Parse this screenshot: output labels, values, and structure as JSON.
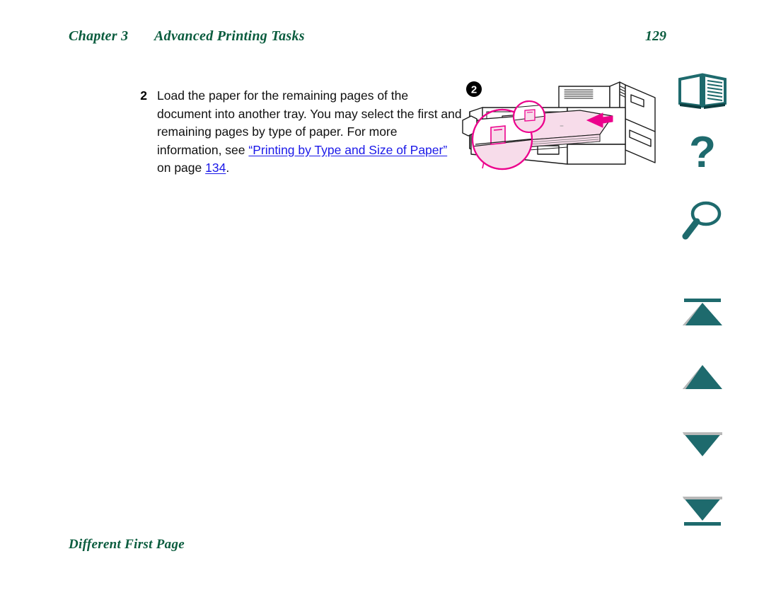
{
  "header": {
    "chapter_label": "Chapter 3",
    "chapter_title": "Advanced Printing Tasks",
    "page_number": "129",
    "color": "#0a5c3e"
  },
  "step": {
    "number": "2",
    "text_part1": "Load the paper for the remaining pages of the document into another tray. You may select the first and remaining pages by type of paper. For more information, see ",
    "link_label": "“Printing by Type and Size of Paper”",
    "text_part2": " on page ",
    "page_link": "134",
    "text_part3": ".",
    "link_color": "#1a18e8"
  },
  "illustration": {
    "name": "printer-tray-loading-paper",
    "badge_number": "2",
    "callout_color": "#ec008c",
    "paper_color": "#f7dcea",
    "line_color": "#1a1a1a"
  },
  "icon_rail": {
    "accent_color": "#1e6a6d",
    "items": [
      {
        "name": "open-book-icon",
        "label": "Contents"
      },
      {
        "name": "question-mark-icon",
        "label": "Help"
      },
      {
        "name": "magnifier-icon",
        "label": "Search"
      },
      {
        "name": "go-to-first-page-icon",
        "label": "First page"
      },
      {
        "name": "previous-page-icon",
        "label": "Previous page"
      },
      {
        "name": "next-page-icon",
        "label": "Next page"
      },
      {
        "name": "go-to-last-page-icon",
        "label": "Last page"
      }
    ]
  },
  "footer": {
    "section_title": "Different First Page"
  }
}
